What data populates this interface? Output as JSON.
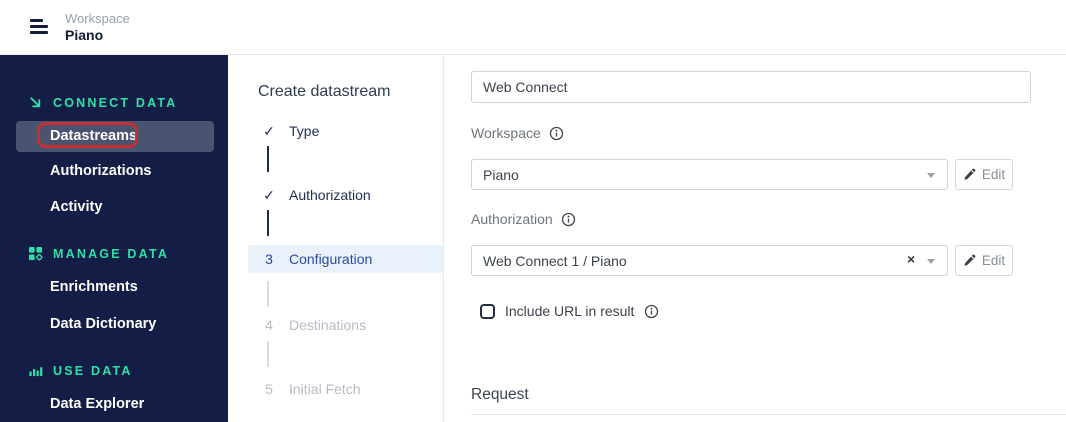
{
  "topbar": {
    "workspace_label": "Workspace",
    "workspace_name": "Piano"
  },
  "sidebar": {
    "sections": [
      {
        "label": "CONNECT DATA",
        "icon": "arrow-down-right-icon",
        "items": [
          {
            "label": "Datastreams",
            "active": true,
            "annotated": true
          },
          {
            "label": "Authorizations",
            "active": false
          },
          {
            "label": "Activity",
            "active": false
          }
        ]
      },
      {
        "label": "MANAGE DATA",
        "icon": "grid-icon",
        "items": [
          {
            "label": "Enrichments",
            "active": false
          },
          {
            "label": "Data Dictionary",
            "active": false
          }
        ]
      },
      {
        "label": "USE DATA",
        "icon": "bar-chart-icon",
        "items": [
          {
            "label": "Data Explorer",
            "active": false
          }
        ]
      }
    ]
  },
  "wizard": {
    "title": "Create datastream",
    "steps": [
      {
        "marker": "✓",
        "label": "Type",
        "state": "done"
      },
      {
        "marker": "✓",
        "label": "Authorization",
        "state": "done"
      },
      {
        "marker": "3",
        "label": "Configuration",
        "state": "active"
      },
      {
        "marker": "4",
        "label": "Destinations",
        "state": "pending"
      },
      {
        "marker": "5",
        "label": "Initial Fetch",
        "state": "pending"
      }
    ]
  },
  "form": {
    "name_value": "Web Connect",
    "workspace_label": "Workspace",
    "workspace_value": "Piano",
    "authorization_label": "Authorization",
    "authorization_value": "Web Connect 1 / Piano",
    "clear_glyph": "×",
    "edit_label": "Edit",
    "include_url_label": "Include URL in result",
    "include_url_checked": false,
    "request_heading": "Request"
  },
  "colors": {
    "sidebar_bg": "#141d45",
    "accent_teal": "#2ee0a8",
    "active_step_text": "#2c4b9e",
    "active_step_bg": "#e9f1fa",
    "annotation_red": "#c43030"
  }
}
